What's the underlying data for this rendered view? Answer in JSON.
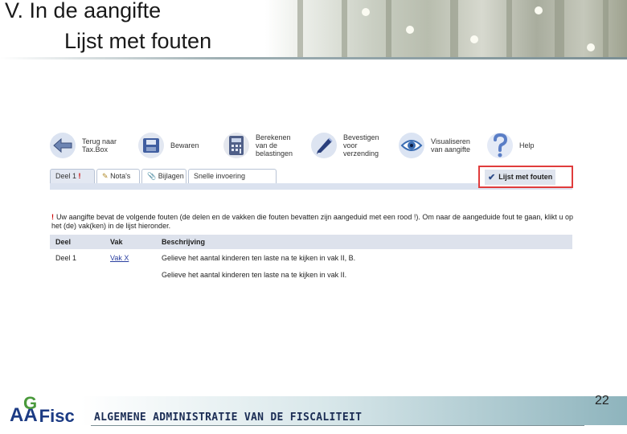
{
  "slide": {
    "title": "V. In de aangifte",
    "subtitle": "Lijst met fouten",
    "page_number": "22",
    "footer_text": "ALGEMENE ADMINISTRATIE VAN DE FISCALITEIT",
    "logo_prefix": "AA",
    "logo_letter": "G",
    "logo_suffix": "Fisc"
  },
  "toolbar": {
    "items": [
      {
        "label": "Terug naar\nTax.Box",
        "icon": "back-arrow-icon",
        "color": "#6d85b3"
      },
      {
        "label": "Bewaren",
        "icon": "save-icon",
        "color": "#405ea0"
      },
      {
        "label": "Berekenen\nvan de\nbelastingen",
        "icon": "calculator-icon",
        "color": "#4f5f88"
      },
      {
        "label": "Bevestigen\nvoor\nverzending",
        "icon": "pen-icon",
        "color": "#2a3f7c"
      },
      {
        "label": "Visualiseren\nvan aangifte",
        "icon": "eye-icon",
        "color": "#3a6db3"
      },
      {
        "label": "Help",
        "icon": "help-icon",
        "color": "#5a7ec6"
      }
    ]
  },
  "tabs": {
    "deel1": "Deel 1",
    "deel1_marker": "!",
    "notas": "Nota's",
    "bijlagen": "Bijlagen",
    "snelle": "Snelle invoering",
    "fouten": "Lijst met fouten"
  },
  "message": {
    "marker": "!",
    "text": "Uw aangifte bevat de volgende fouten (de delen en de vakken die fouten bevatten zijn aangeduid met een rood !). Om naar de aangeduide fout te gaan, klikt u op het (de) vak(ken) in de lijst hieronder."
  },
  "table": {
    "headers": [
      "Deel",
      "Vak",
      "Beschrijving"
    ],
    "rows": [
      {
        "deel": "Deel 1",
        "vak": "Vak X",
        "beschrijving": "Gelieve het aantal kinderen ten laste na te kijken in vak II, B."
      },
      {
        "deel": "",
        "vak": "",
        "beschrijving": "Gelieve het aantal kinderen ten laste na te kijken in vak II."
      }
    ]
  },
  "colors": {
    "highlight": "#e03c3c",
    "tab_bar": "#dbe2ef",
    "header_row": "#dde2ec",
    "brand_blue": "#1c3b84",
    "brand_green": "#4a9a3c"
  }
}
